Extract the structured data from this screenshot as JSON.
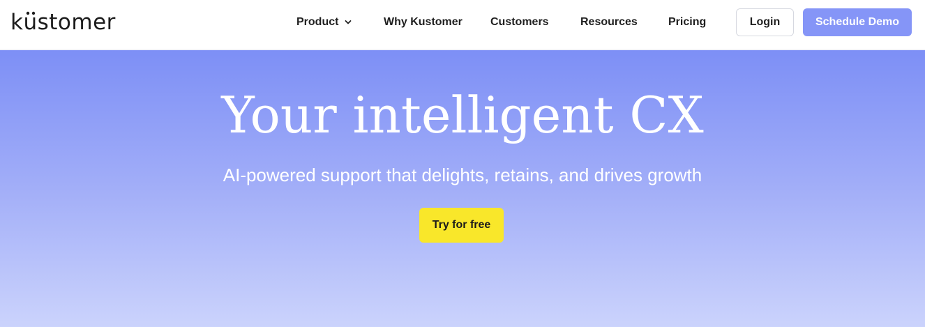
{
  "header": {
    "logo": {
      "before": "k",
      "accent": "u",
      "after": "stomer"
    },
    "nav": [
      {
        "label": "Product",
        "has_dropdown": true
      },
      {
        "label": "Why Kustomer"
      },
      {
        "label": "Customers"
      },
      {
        "label": "Resources"
      },
      {
        "label": "Pricing"
      }
    ],
    "login_label": "Login",
    "demo_label": "Schedule Demo"
  },
  "hero": {
    "title": "Your intelligent CX",
    "subtitle": "AI-powered support that delights, retains, and drives growth",
    "cta_label": "Try for free"
  },
  "colors": {
    "accent": "#8595f7",
    "cta": "#f9e72a",
    "hero_top": "#7d8ff6",
    "hero_bottom": "#cbd3fc",
    "text_dark": "#1f1f1f"
  },
  "icons": {
    "dropdown": "chevron-down-icon",
    "logo_mark": "logo-dots-icon"
  }
}
